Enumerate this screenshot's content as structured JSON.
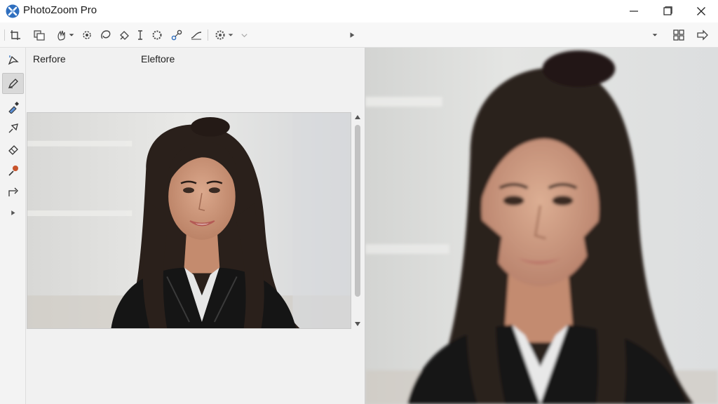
{
  "window": {
    "title": "PhotoZoom Pro",
    "controls": [
      "minimize",
      "maximize",
      "close"
    ]
  },
  "toolbar": {
    "left_icons": [
      "crop-icon",
      "copy-icon",
      "hand-icon",
      "settings-icon",
      "lasso-icon",
      "brush-icon",
      "text-cursor-icon",
      "gear-icon",
      "nodes-icon",
      "curve-icon",
      "preset-gear-icon"
    ],
    "right_icons": [
      "chevron-down-icon",
      "grid-icon",
      "export-arrow-icon"
    ]
  },
  "sidetools": [
    "selection-tool-icon",
    "pen-tool-icon",
    "dropper-icon",
    "pin-icon",
    "eraser-icon",
    "paint-tool-icon",
    "redo-arrow-icon",
    "expand-arrow-icon"
  ],
  "preview": {
    "before_label": "Rerfore",
    "after_label": "Eleftore"
  },
  "colors": {
    "accent": "#2f6fbf",
    "background": "#f3f3f3"
  }
}
